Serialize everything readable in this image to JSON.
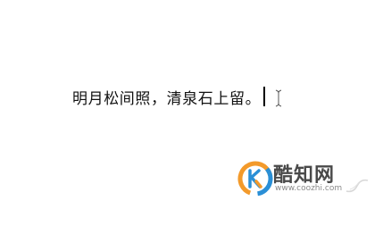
{
  "document": {
    "text": "明月松间照，清泉石上留。"
  },
  "watermark": {
    "name": "酷知网",
    "url": "www.coozhi.com",
    "logo_colors": {
      "orange": "#f39a2b",
      "blue": "#2a8fd6"
    }
  }
}
